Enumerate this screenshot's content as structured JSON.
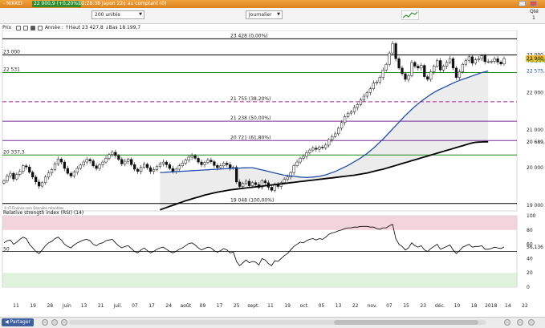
{
  "window": {
    "title": "- NIKKEI",
    "price_badge": "22 900,9 (+0,20%)",
    "time_info": "02:28:38 Japon 22¢ au comptant (0)"
  },
  "toolbar": {
    "units_select": "200 unités",
    "period_select": "Journalier",
    "qty_label": "Qté",
    "qty_value": "1"
  },
  "legend": {
    "prefix": "Prix",
    "text": "Année : ↑Haut 23 427,8 ↓Bas 18 199,7"
  },
  "bottom": {
    "share_label": "Partager"
  },
  "chart_data": [
    {
      "type": "candlestick",
      "title": "Prix",
      "source": "© IT-Finance.com Données retardées",
      "x_labels": [
        "11",
        "19",
        "28",
        "juin",
        "13",
        "21",
        "juil.",
        "07",
        "17",
        "24",
        "août",
        "09",
        "17",
        "25",
        "sept.",
        "11",
        "19",
        "oct.",
        "05",
        "13",
        "22",
        "nov.",
        "07",
        "15",
        "23",
        "déc.",
        "10",
        "18",
        "2018",
        "14",
        "22"
      ],
      "y_ticks": [
        "19 000",
        "20 000",
        "21 000",
        "22 000",
        "23 000"
      ],
      "ylim": [
        18850,
        23650
      ],
      "price_tags": [
        {
          "label": "22 900,9",
          "value": 22900.9,
          "color": "#f6c22c"
        },
        {
          "label": "+0,20%",
          "value": 22840,
          "color": "#2a8a2a"
        },
        {
          "label": "22 575,1",
          "value": 22575.1,
          "color": "#1f4fa8"
        },
        {
          "label": "20 689,6",
          "value": 20689.6,
          "color": "#000000"
        }
      ],
      "horizontal_lines": [
        {
          "label": "23 428 (0,00%)",
          "value": 23428,
          "color": "#000000",
          "style": "solid"
        },
        {
          "label": "23 000",
          "value": 23000,
          "color": "#000000",
          "style": "solid",
          "side": "left"
        },
        {
          "label": "22 531",
          "value": 22531,
          "color": "#1a8a1a",
          "style": "solid",
          "side": "left"
        },
        {
          "label": "21 755 (38,20%)",
          "value": 21755,
          "color": "#b3249c",
          "style": "dashed"
        },
        {
          "label": "21 238 (50,00%)",
          "value": 21238,
          "color": "#7a2f9a",
          "style": "solid"
        },
        {
          "label": "20 721 (61,80%)",
          "value": 20721,
          "color": "#7a2f9a",
          "style": "solid"
        },
        {
          "label": "20 337,3",
          "value": 20337.3,
          "color": "#1a8a1a",
          "style": "solid",
          "side": "left"
        },
        {
          "label": "19 048 (100,00%)",
          "value": 19048,
          "color": "#000000",
          "style": "solid"
        }
      ],
      "series": [
        {
          "name": "",
          "kind": "close",
          "values": [
            19650,
            19780,
            19850,
            19700,
            19820,
            19900,
            20050,
            20020,
            19880,
            19750,
            19620,
            19510,
            19600,
            19750,
            19860,
            19950,
            20100,
            20230,
            20150,
            19980,
            19850,
            19780,
            19880,
            19980,
            20070,
            20150,
            20220,
            20180,
            20050,
            19980,
            20080,
            20150,
            20250,
            20350,
            20410,
            20320,
            20220,
            20100,
            20170,
            20220,
            20080,
            19960,
            19900,
            20010,
            20090,
            20000,
            19900,
            19950,
            20030,
            20100,
            20150,
            20080,
            19980,
            19900,
            19960,
            20050,
            20120,
            20200,
            20280,
            20320,
            20250,
            20150,
            20080,
            20140,
            20200,
            20160,
            20060,
            20000,
            20050,
            20120,
            20080,
            19990,
            20010,
            19620,
            19500,
            19580,
            19640,
            19520,
            19600,
            19550,
            19470,
            19650,
            19600,
            19480,
            19400,
            19550,
            19500,
            19600,
            19690,
            19750,
            19870,
            20050,
            20150,
            20250,
            20300,
            20400,
            20470,
            20520,
            20490,
            20550,
            20530,
            20600,
            20750,
            20830,
            20900,
            21050,
            21200,
            21360,
            21450,
            21480,
            21600,
            21680,
            21800,
            21900,
            22000,
            22100,
            22250,
            22280,
            22400,
            22600,
            22750,
            23050,
            23300,
            22900,
            22650,
            22500,
            22350,
            22450,
            22800,
            22700,
            22650,
            22720,
            22420,
            22350,
            22550,
            22700,
            22850,
            22600,
            22700,
            22800,
            22900,
            22650,
            22400,
            22550,
            22750,
            22850,
            22950,
            22780,
            22870,
            22900,
            22980,
            22820,
            22820,
            22830,
            22900,
            22810,
            22760,
            22900.9
          ]
        },
        {
          "name": "",
          "kind": "ma_short",
          "color": "#1f4fa8",
          "start_index": 49,
          "values": [
            19870,
            19875,
            19880,
            19885,
            19890,
            19895,
            19900,
            19905,
            19910,
            19915,
            19920,
            19925,
            19930,
            19935,
            19940,
            19945,
            19950,
            19955,
            19960,
            19965,
            19970,
            19975,
            19980,
            19985,
            19990,
            19990,
            19995,
            19995,
            20000,
            20000,
            19980,
            19960,
            19940,
            19920,
            19900,
            19880,
            19860,
            19840,
            19820,
            19800,
            19790,
            19780,
            19770,
            19760,
            19750,
            19745,
            19740,
            19745,
            19750,
            19760,
            19770,
            19790,
            19810,
            19840,
            19870,
            19900,
            19940,
            19980,
            20020,
            20060,
            20110,
            20160,
            20210,
            20260,
            20320,
            20380,
            20450,
            20520,
            20600,
            20680,
            20760,
            20850,
            20940,
            21030,
            21120,
            21210,
            21300,
            21390,
            21470,
            21550,
            21630,
            21700,
            21770,
            21830,
            21890,
            21950,
            22000,
            22050,
            22090,
            22130,
            22170,
            22210,
            22250,
            22290,
            22320,
            22350,
            22380,
            22410,
            22440,
            22470,
            22500,
            22530,
            22550,
            22575.1
          ]
        },
        {
          "name": "",
          "kind": "ma_long",
          "color": "#000000",
          "start_index": 49,
          "values": [
            18880,
            18910,
            18940,
            18970,
            19000,
            19030,
            19060,
            19090,
            19120,
            19145,
            19170,
            19195,
            19220,
            19245,
            19270,
            19290,
            19310,
            19330,
            19350,
            19365,
            19380,
            19395,
            19410,
            19420,
            19430,
            19440,
            19450,
            19460,
            19470,
            19480,
            19490,
            19500,
            19510,
            19520,
            19530,
            19540,
            19550,
            19560,
            19570,
            19580,
            19590,
            19600,
            19610,
            19620,
            19630,
            19640,
            19650,
            19660,
            19670,
            19680,
            19690,
            19700,
            19710,
            19720,
            19730,
            19740,
            19750,
            19760,
            19770,
            19780,
            19790,
            19800,
            19815,
            19830,
            19845,
            19860,
            19880,
            19900,
            19920,
            19940,
            19960,
            19985,
            20010,
            20035,
            20060,
            20085,
            20110,
            20135,
            20160,
            20185,
            20210,
            20235,
            20260,
            20285,
            20310,
            20335,
            20360,
            20385,
            20410,
            20435,
            20460,
            20485,
            20510,
            20535,
            20560,
            20585,
            20610,
            20635,
            20660,
            20675,
            20680,
            20685,
            20688,
            20689.6
          ]
        }
      ]
    },
    {
      "type": "line",
      "title": "Relative strength index (RSI) (14)",
      "y_ticks": [
        "0",
        "20",
        "40",
        "60",
        "80",
        "100"
      ],
      "ylim": [
        0,
        100
      ],
      "reference_lines": [
        {
          "label": "50",
          "value": 50
        }
      ],
      "value_tag": {
        "label": "56,136",
        "value": 56.136
      },
      "zones": [
        {
          "from": 80,
          "to": 100,
          "color": "#f3d4dc"
        },
        {
          "from": 0,
          "to": 20,
          "color": "#dff3dc"
        }
      ],
      "series": [
        {
          "name": "Relative strength index (RSI) (14)",
          "color": "#000000",
          "values": [
            62,
            65,
            66,
            60,
            63,
            67,
            70,
            68,
            60,
            55,
            50,
            47,
            52,
            58,
            62,
            64,
            68,
            70,
            66,
            60,
            57,
            55,
            59,
            62,
            64,
            66,
            67,
            65,
            60,
            58,
            61,
            62,
            65,
            66,
            67,
            62,
            58,
            55,
            57,
            58,
            54,
            50,
            48,
            52,
            55,
            51,
            48,
            50,
            53,
            55,
            56,
            53,
            50,
            48,
            50,
            53,
            55,
            58,
            61,
            62,
            59,
            55,
            52,
            54,
            56,
            55,
            51,
            49,
            51,
            54,
            52,
            48,
            49,
            36,
            30,
            34,
            38,
            34,
            36,
            35,
            31,
            40,
            38,
            33,
            30,
            37,
            36,
            40,
            44,
            47,
            52,
            57,
            60,
            63,
            62,
            65,
            67,
            68,
            66,
            68,
            67,
            70,
            74,
            76,
            77,
            79,
            80,
            82,
            83,
            83,
            84,
            84,
            85,
            85,
            85,
            84,
            84,
            82,
            81,
            83,
            83,
            86,
            88,
            68,
            60,
            57,
            52,
            55,
            62,
            58,
            56,
            58,
            52,
            50,
            54,
            57,
            60,
            53,
            55,
            57,
            59,
            52,
            47,
            51,
            56,
            58,
            60,
            56,
            57,
            57,
            58,
            53,
            53,
            54,
            56,
            55,
            54,
            56.136
          ]
        }
      ]
    }
  ]
}
